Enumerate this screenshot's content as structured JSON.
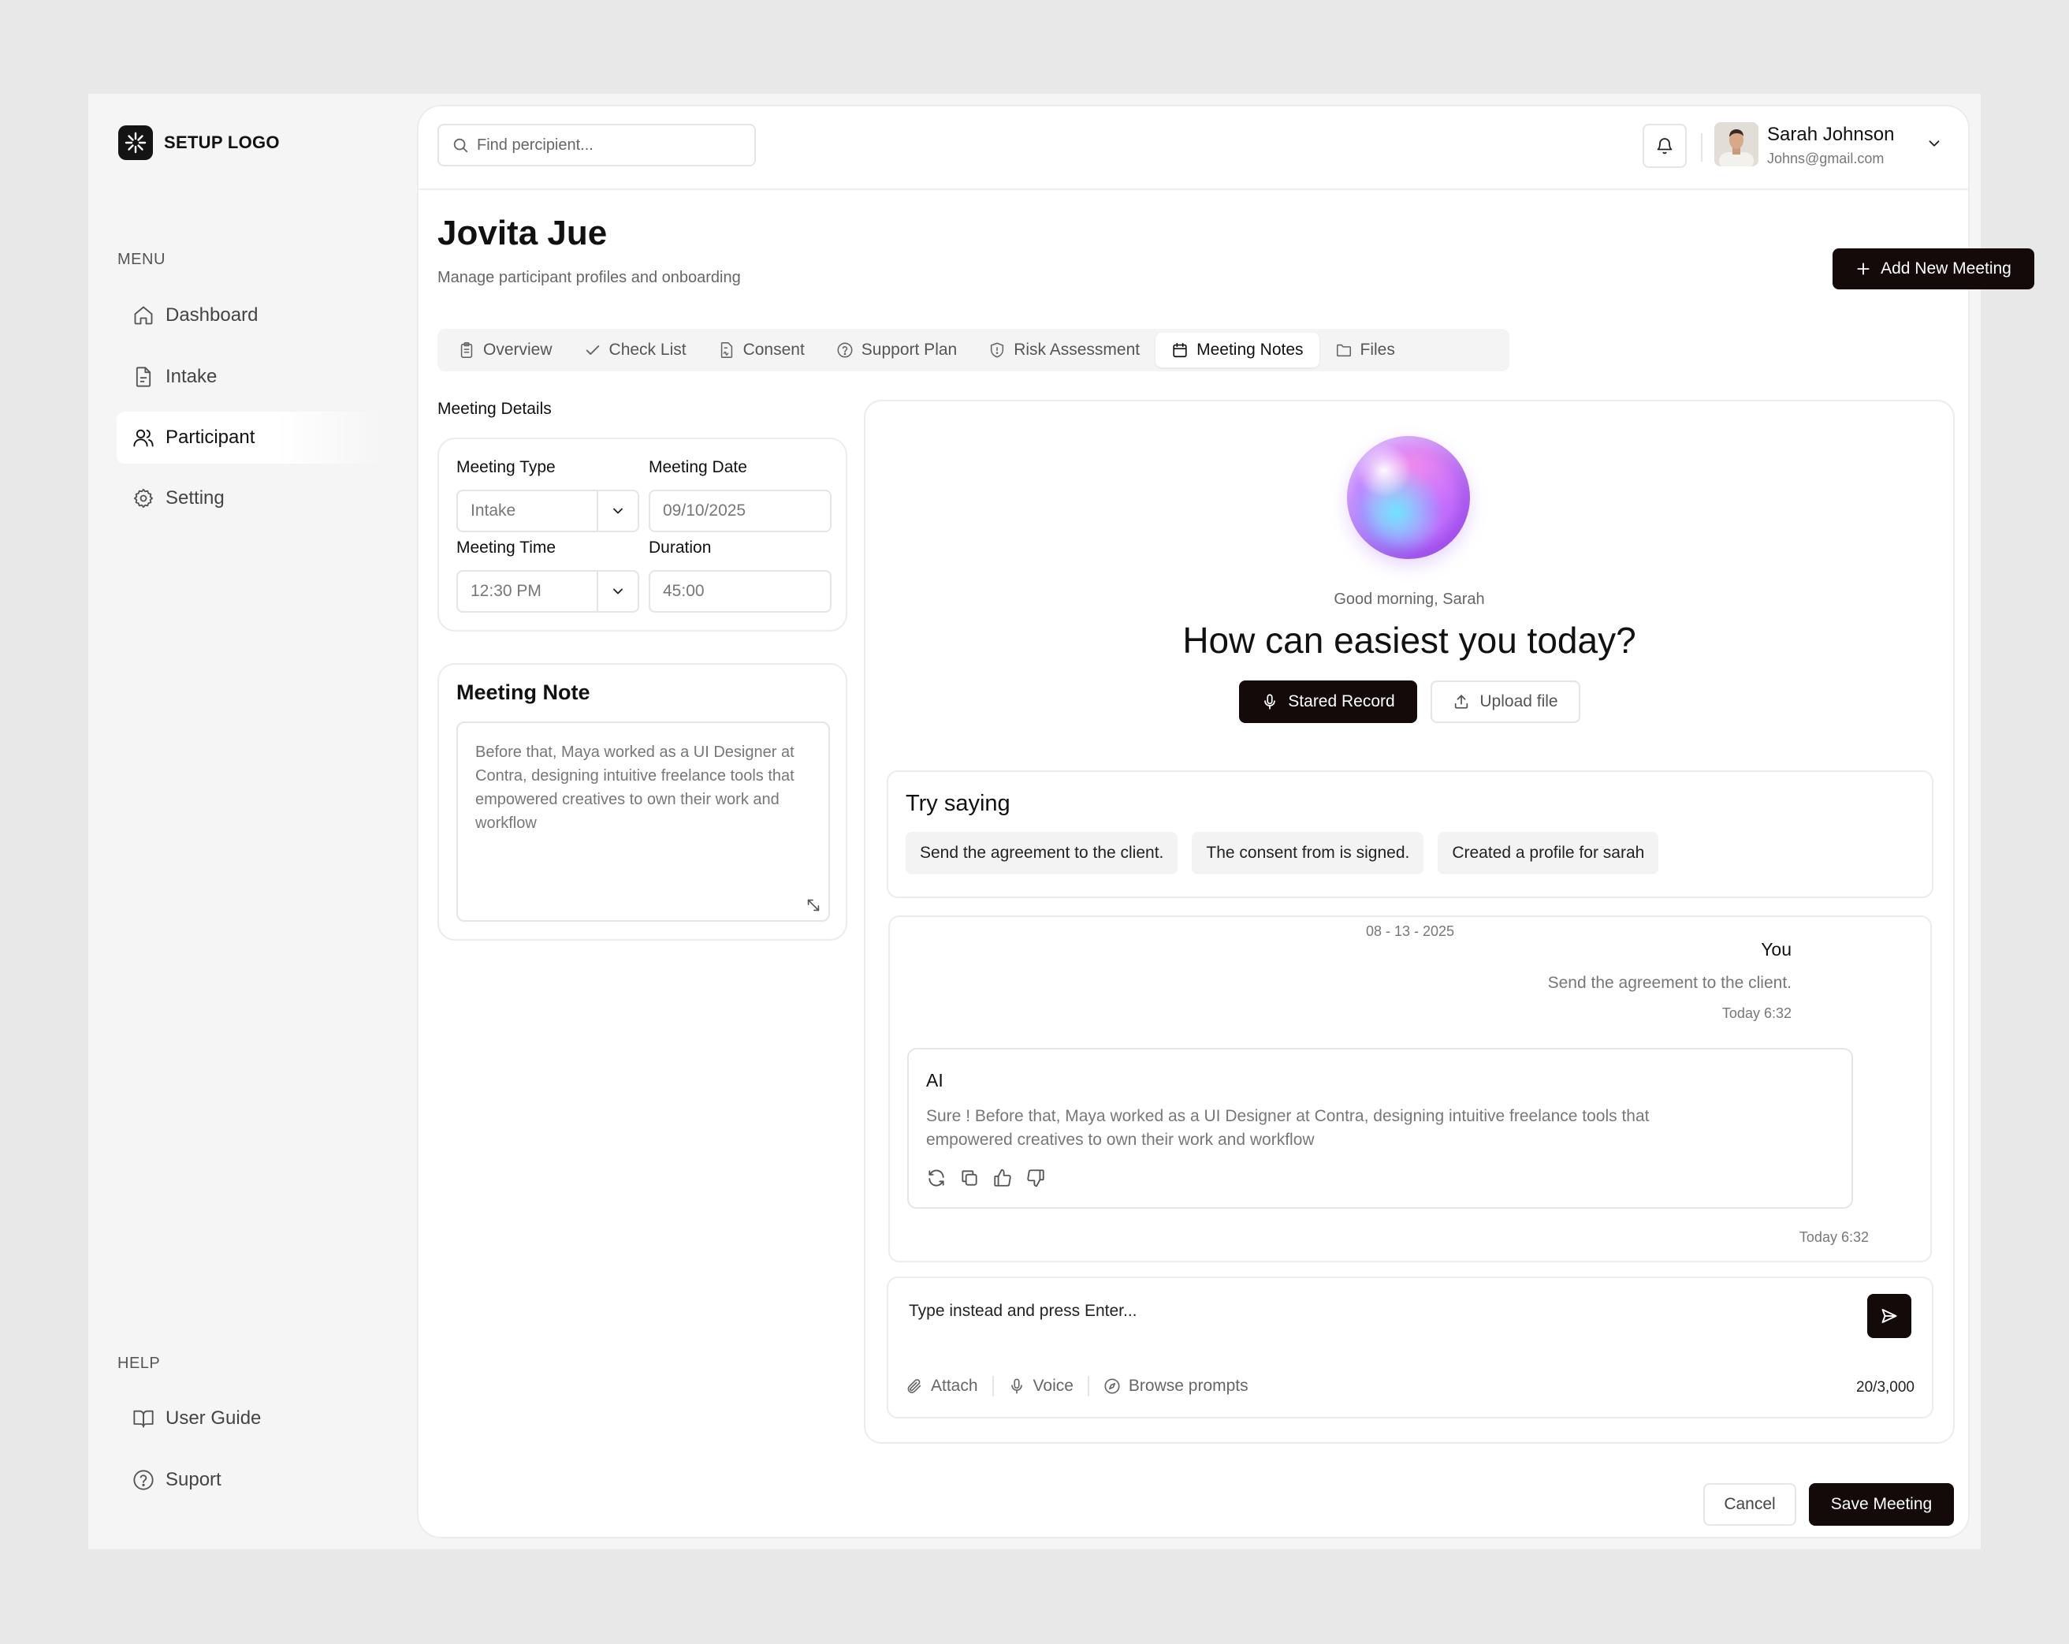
{
  "sidebar": {
    "logo_text": "SETUP LOGO",
    "menu_label": "MENU",
    "menu_items": [
      {
        "label": "Dashboard",
        "icon": "home-icon"
      },
      {
        "label": "Intake",
        "icon": "file-icon"
      },
      {
        "label": "Participant",
        "icon": "users-icon",
        "active": true
      },
      {
        "label": "Setting",
        "icon": "gear-icon"
      }
    ],
    "help_label": "HELP",
    "help_items": [
      {
        "label": "User Guide",
        "icon": "book-icon"
      },
      {
        "label": "Suport",
        "icon": "help-circle-icon"
      }
    ]
  },
  "topbar": {
    "search_placeholder": "Find percipient...",
    "user_name": "Sarah Johnson",
    "user_email": "Johns@gmail.com"
  },
  "page": {
    "title": "Jovita Jue",
    "subtitle": "Manage participant profiles and onboarding",
    "add_button": "Add New Meeting"
  },
  "tabs": [
    {
      "label": "Overview",
      "icon": "clipboard-icon"
    },
    {
      "label": "Check List",
      "icon": "check-icon"
    },
    {
      "label": "Consent",
      "icon": "signed-doc-icon"
    },
    {
      "label": "Support Plan",
      "icon": "help-circle-icon"
    },
    {
      "label": "Risk Assessment",
      "icon": "shield-icon"
    },
    {
      "label": "Meeting Notes",
      "icon": "calendar-icon",
      "active": true
    },
    {
      "label": "Files",
      "icon": "folder-icon"
    }
  ],
  "meeting_details": {
    "section_label": "Meeting Details",
    "type_label": "Meeting Type",
    "type_value": "Intake",
    "date_label": "Meeting Date",
    "date_value": "09/10/2025",
    "time_label": "Meeting Time",
    "time_value": "12:30 PM",
    "duration_label": "Duration",
    "duration_value": "45:00"
  },
  "meeting_note": {
    "title": "Meeting Note",
    "text": "Before that, Maya worked as a UI Designer at Contra, designing intuitive freelance tools that empowered creatives to own their work and workflow"
  },
  "assistant": {
    "greeting": "Good  morning, Sarah",
    "headline": "How can easiest you today?",
    "record_button": "Stared Record",
    "upload_button": "Upload file",
    "try_title": "Try saying",
    "suggestions": [
      "Send the agreement to the client.",
      "The consent from is signed.",
      "Created a profile for sarah"
    ],
    "conversation": {
      "date": "08 - 13 - 2025",
      "user_label": "You",
      "user_message": "Send the agreement to the client.",
      "user_time": "Today 6:32",
      "ai_label": "AI",
      "ai_message": "Sure ! Before that, Maya worked as a UI Designer at Contra, designing intuitive freelance tools that empowered creatives to own their work and workflow",
      "ai_time": "Today 6:32"
    },
    "input_placeholder": "Type instead and press Enter...",
    "tools": {
      "attach": "Attach",
      "voice": "Voice",
      "browse": "Browse prompts"
    },
    "counter": "20/3,000"
  },
  "footer": {
    "cancel": "Cancel",
    "save": "Save Meeting"
  }
}
